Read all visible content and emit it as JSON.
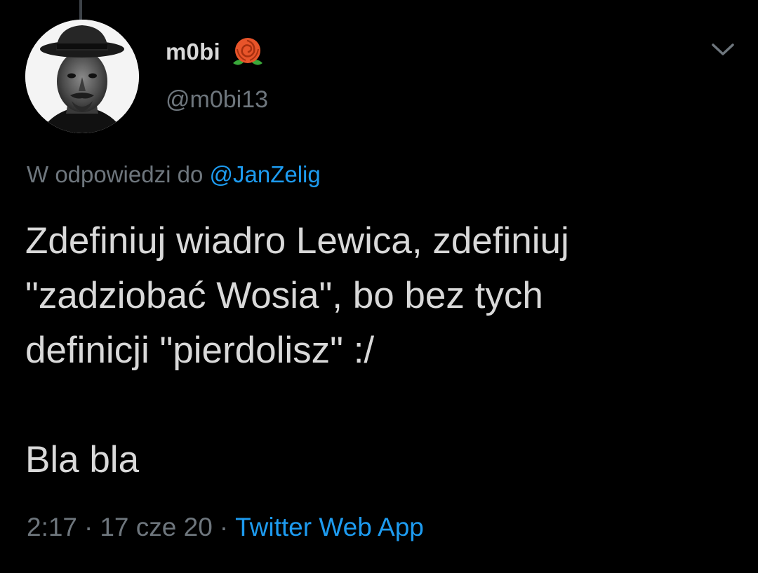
{
  "tweet": {
    "author": {
      "display_name": "m0bi",
      "handle": "@m0bi13",
      "name_emoji": "rose-icon",
      "avatar": "avatar-photo"
    },
    "reply_to": {
      "prefix": "W odpowiedzi do",
      "mention": "@JanZelig"
    },
    "text_paragraphs": [
      "Zdefiniuj wiadro Lewica, zdefiniuj\n\"zadziobać Wosia\", bo bez tych\ndefinicji \"pierdolisz\" :/",
      "Bla bla"
    ],
    "meta": {
      "time": "2:17",
      "separator": "·",
      "date": "17 cze 20",
      "source": "Twitter Web App"
    },
    "menu_icon": "chevron-down-icon"
  },
  "colors": {
    "background": "#000000",
    "text": "#d9d9d9",
    "secondary": "#6e767d",
    "link": "#1d9bf0",
    "rose": "#e8542a"
  }
}
